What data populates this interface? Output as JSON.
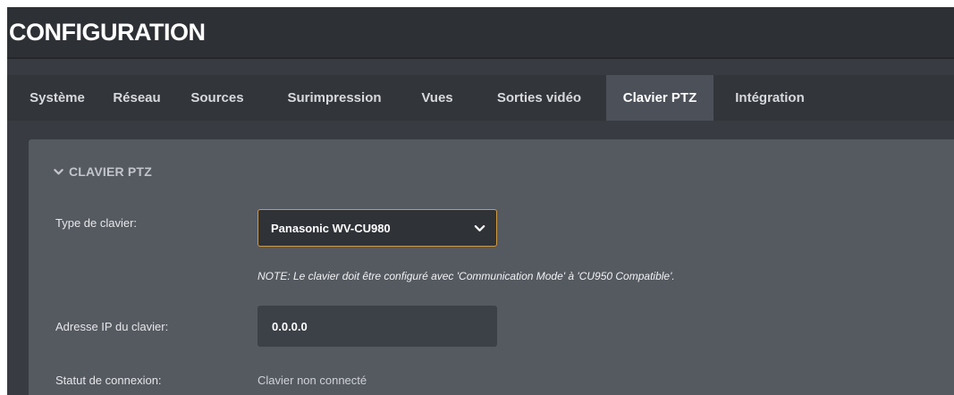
{
  "header": {
    "title": "CONFIGURATION"
  },
  "tabs": [
    {
      "label": "Système",
      "active": false
    },
    {
      "label": "Réseau",
      "active": false
    },
    {
      "label": "Sources",
      "active": false
    },
    {
      "label": "Surimpression",
      "active": false
    },
    {
      "label": "Vues",
      "active": false
    },
    {
      "label": "Sorties vidéo",
      "active": false
    },
    {
      "label": "Clavier PTZ",
      "active": true
    },
    {
      "label": "Intégration",
      "active": false
    }
  ],
  "section": {
    "title": "CLAVIER PTZ",
    "icon": "chevron-down-icon"
  },
  "form": {
    "keyboard_type_label": "Type de clavier:",
    "keyboard_type_value": "Panasonic WV-CU980",
    "note": "NOTE: Le clavier doit être configuré avec 'Communication Mode' à 'CU950 Compatible'.",
    "ip_label": "Adresse IP du clavier:",
    "ip_value": "0.0.0.0",
    "status_label": "Statut de connexion:",
    "status_value": "Clavier non connecté"
  },
  "colors": {
    "background": "#383b42",
    "panel": "#555960",
    "active_tab": "#4c5058",
    "select_border": "#d39a3a"
  }
}
